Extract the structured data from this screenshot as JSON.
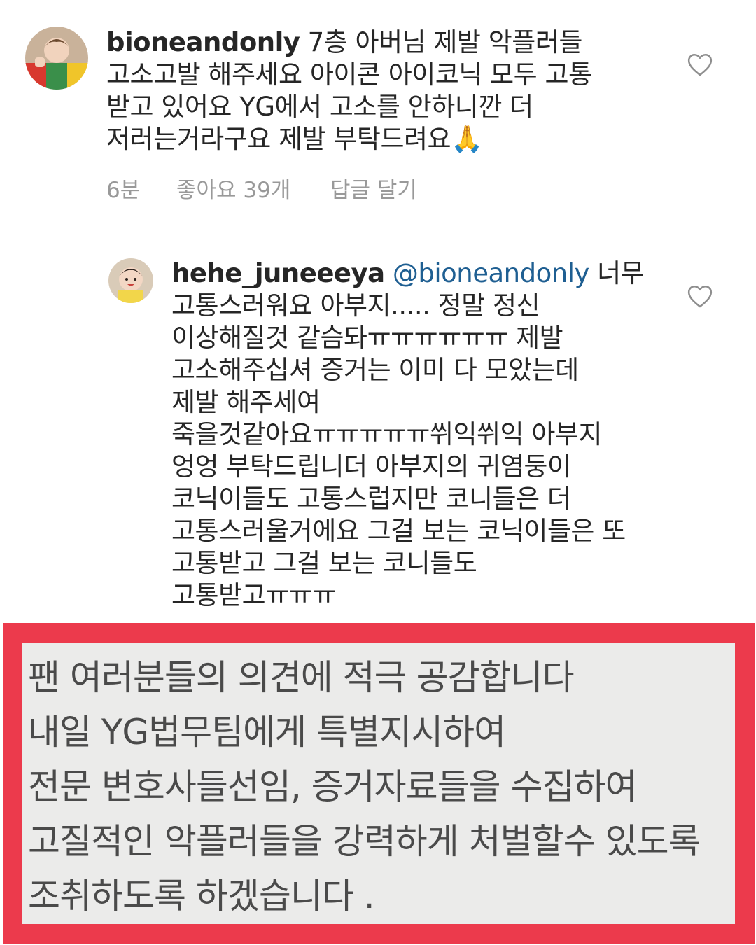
{
  "comment": {
    "username": "bioneandonly",
    "lines_first_rest": "7층 아버님 제발 악플러들",
    "lines": [
      "고소고발 해주세요 아이콘 아이코닉 모두 고통",
      "받고  있어요 YG에서 고소를 안하니깐 더",
      "저러는거라구요 제발 부탁드려요🙏"
    ],
    "time": "6분",
    "likes": "좋아요 39개",
    "reply_label": "답글 달기",
    "heart_icon": "heart-outline-icon"
  },
  "reply": {
    "username": "hehe_juneeeya",
    "mention": "@bioneandonly",
    "lines_first_rest": "너무",
    "lines": [
      "고통스러워요 아부지..... 정말 정신",
      "이상해질것 같슴돠ㅠㅠㅠㅠㅠㅠ 제발",
      "고소해주십셔 증거는 이미 다 모았는데",
      "제발 해주세여",
      "죽을것같아요ㅠㅠㅠㅠㅠ쒸익쒸익 아부지",
      "엉엉 부탁드립니더 아부지의 귀염둥이",
      "코닉이들도 고통스럽지만 코니들은 더",
      "고통스러울거에요 그걸 보는 코닉이들은 또",
      "고통받고 그걸 보는 코니들도",
      "고통받고ㅠㅠㅠ"
    ],
    "heart_icon": "heart-outline-icon"
  },
  "notice": {
    "border_color": "#ec3a4c",
    "lines": [
      "팬 여러분들의 의견에 적극 공감합니다",
      "내일 YG법무팀에게 특별지시하여",
      "전문 변호사들선임, 증거자료들을 수집하여",
      "고질적인 악플러들을 강력하게 처벌할수 있도록",
      "조취하도록 하겠습니다 ."
    ]
  }
}
